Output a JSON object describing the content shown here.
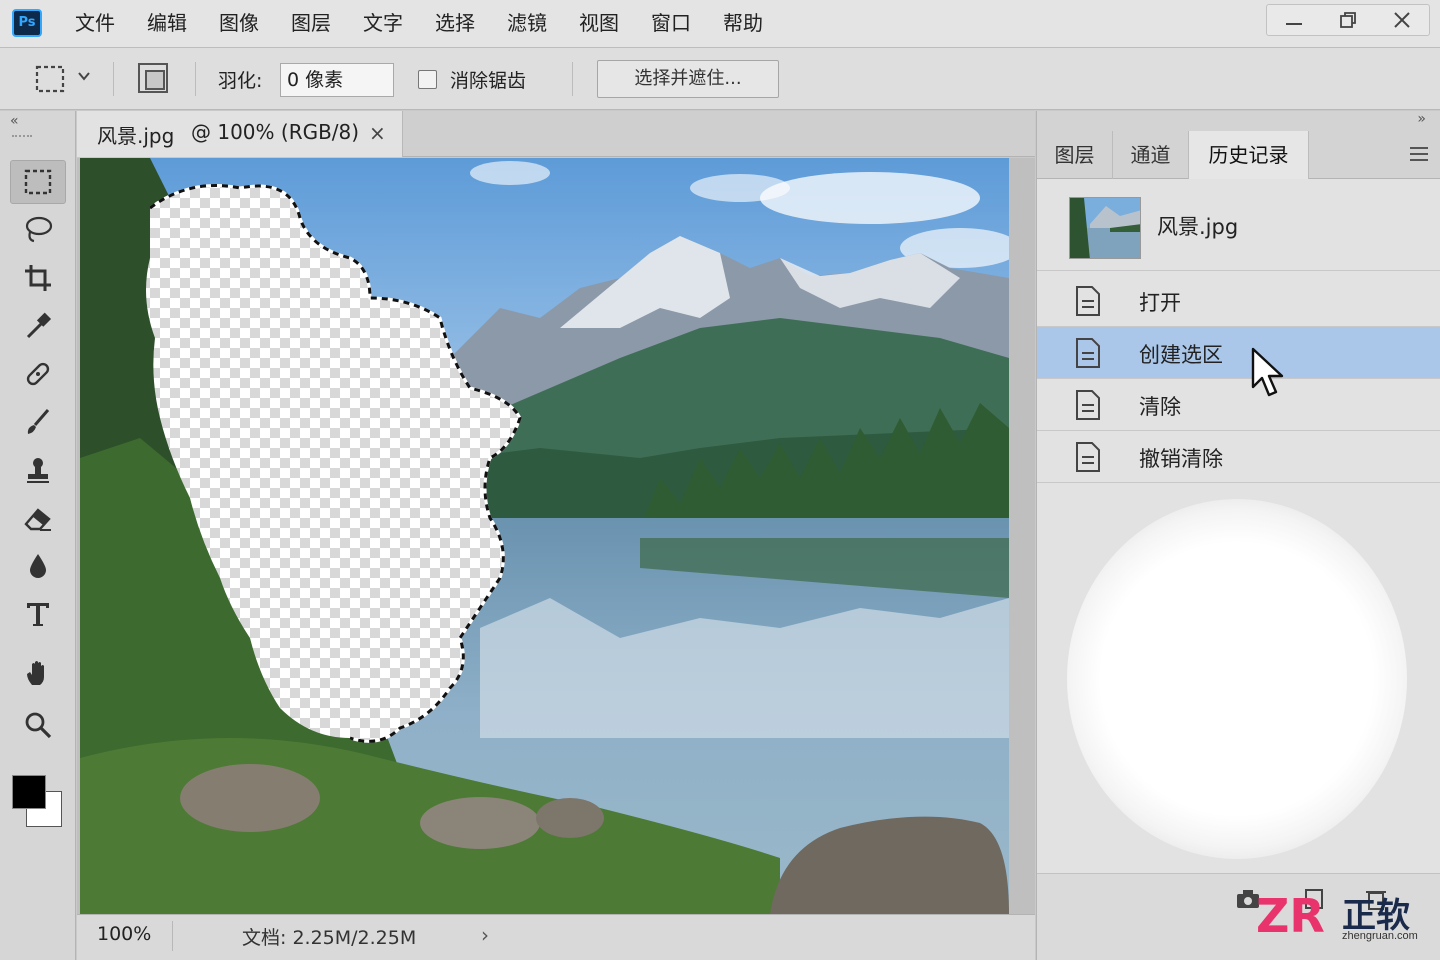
{
  "app": {
    "logo": "Ps"
  },
  "menu": [
    "文件",
    "编辑",
    "图像",
    "图层",
    "文字",
    "选择",
    "滤镜",
    "视图",
    "窗口",
    "帮助"
  ],
  "window_controls": [
    "minimize-icon",
    "restore-icon",
    "close-icon"
  ],
  "options": {
    "feather_label": "羽化:",
    "feather_value": "0 像素",
    "antialias_label": "消除锯齿",
    "antialias_checked": false,
    "select_mask_label": "选择并遮住..."
  },
  "tools": [
    "rectangular-marquee-tool",
    "lasso-tool",
    "crop-tool",
    "eyedropper-tool",
    "healing-brush-tool",
    "brush-tool",
    "clone-stamp-tool",
    "eraser-tool",
    "blur-tool",
    "type-tool",
    "hand-tool",
    "zoom-tool"
  ],
  "colors": {
    "foreground": "#000000",
    "background": "#ffffff",
    "selected_row": "#aac7ea",
    "ps_blue": "#31a8ff"
  },
  "document": {
    "name": "风景.jpg",
    "info": "@ 100% (RGB/8)",
    "close": "×"
  },
  "status": {
    "zoom": "100%",
    "doc_size": "文档: 2.25M/2.25M",
    "arrow": "›"
  },
  "panel": {
    "tabs": [
      "图层",
      "通道",
      "历史记录"
    ],
    "active_tab": "历史记录",
    "snapshot_name": "风景.jpg",
    "history": [
      {
        "label": "打开",
        "selected": false
      },
      {
        "label": "创建选区",
        "selected": true
      },
      {
        "label": "清除",
        "selected": false
      },
      {
        "label": "撤销清除",
        "selected": false
      }
    ]
  },
  "watermark": {
    "main": "正软",
    "sub": "zhengruan.com",
    "logo": "ZR"
  }
}
